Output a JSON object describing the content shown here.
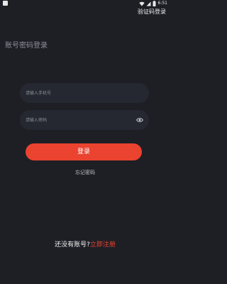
{
  "status_bar": {
    "time": "6:51"
  },
  "header": {
    "switch_mode_label": "验证码登录"
  },
  "page": {
    "title": "账号密码登录"
  },
  "form": {
    "phone_placeholder": "请输入手机号",
    "phone_value": "",
    "password_placeholder": "请输入密码",
    "password_value": "",
    "login_label": "登录",
    "forgot_label": "忘记密码"
  },
  "footer": {
    "question": "还没有账号?",
    "register_label": "立即注册"
  },
  "colors": {
    "background": "#1e1f25",
    "field_background": "#262831",
    "accent": "#ea4330"
  },
  "icons": {
    "password_toggle": "eye-icon"
  }
}
